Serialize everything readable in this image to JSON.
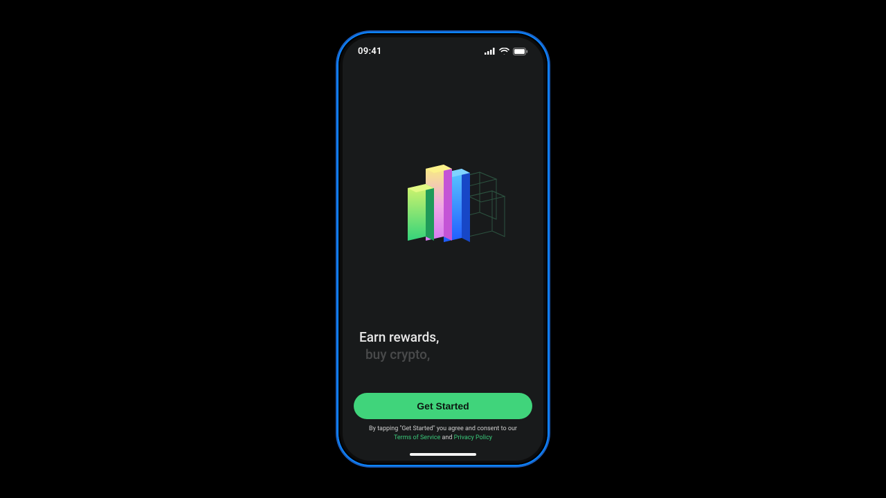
{
  "status": {
    "time": "09:41"
  },
  "tagline": {
    "active": "Earn rewards,",
    "inactive": "buy crypto,"
  },
  "cta": {
    "label": "Get Started"
  },
  "legal": {
    "prefix": "By tapping \"Get Started\" you agree and consent to our",
    "tos": "Terms of Service",
    "and": " and ",
    "privacy": "Privacy Policy"
  },
  "colors": {
    "accent": "#40d47b",
    "link": "#3ac97a"
  }
}
